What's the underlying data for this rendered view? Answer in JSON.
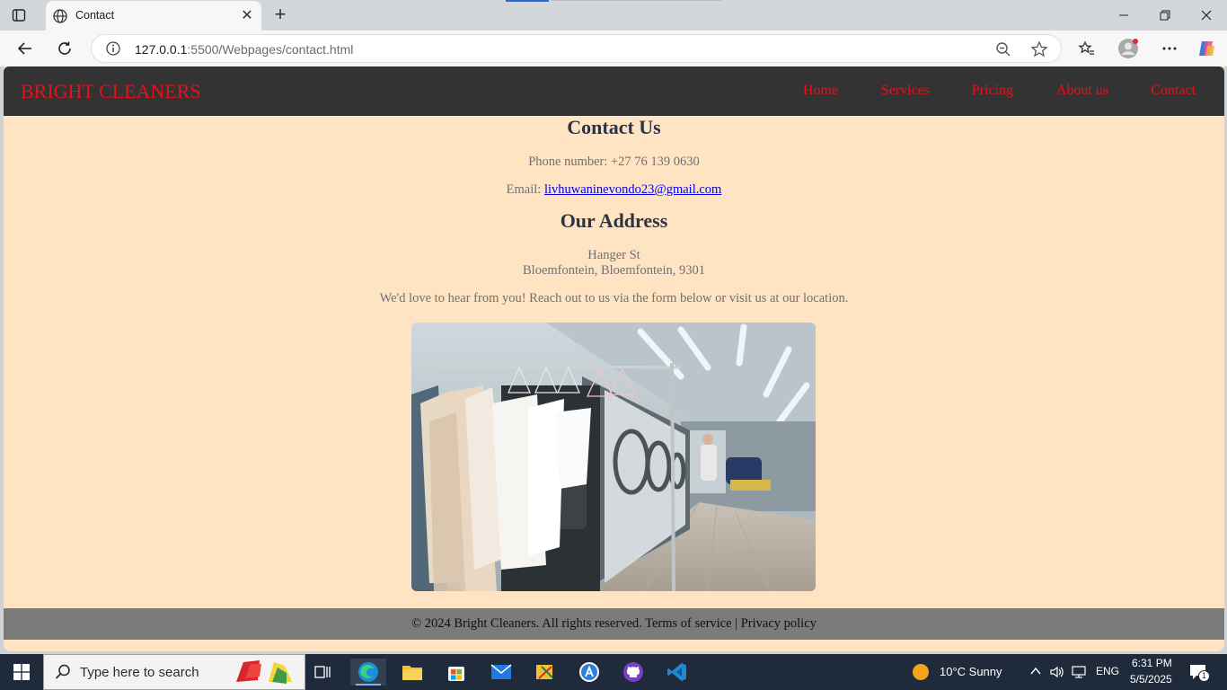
{
  "browser": {
    "tab_title": "Contact",
    "url_host": "127.0.0.1",
    "url_path": ":5500/Webpages/contact.html"
  },
  "site": {
    "brand": "BRIGHT CLEANERS",
    "nav": [
      "Home",
      "Services",
      "Pricing",
      "About us",
      "Contact"
    ],
    "contact_heading": "Contact Us",
    "phone_line": "Phone number: +27 76 139 0630",
    "email_label": "Email: ",
    "email": "livhuwaninevondo23@gmail.com",
    "address_heading": "Our Address",
    "address_line1": "Hanger St",
    "address_line2": "Bloemfontein, Bloemfontein, 9301",
    "invite": "We'd love to hear from you! Reach out to us via the form below or visit us at our location.",
    "footer_copy": "© 2024 Bright Cleaners. All rights reserved.",
    "footer_terms": "Terms of service",
    "footer_sep": " | ",
    "footer_privacy": "Privacy policy"
  },
  "taskbar": {
    "search_placeholder": "Type here to search",
    "weather": "10°C  Sunny",
    "lang": "ENG",
    "time": "6:31 PM",
    "date": "5/5/2025",
    "notifications": "1"
  },
  "colors": {
    "page_bg": "#ffe4c4",
    "header_bg": "#333333",
    "brand_red": "#e8101a",
    "footer_bg": "#7b7b7b"
  }
}
